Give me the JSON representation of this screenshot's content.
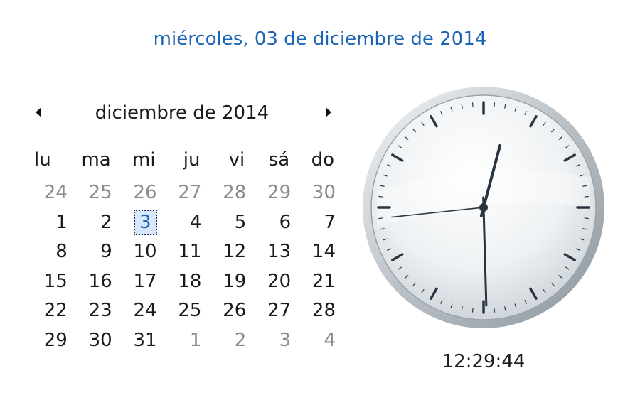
{
  "header": {
    "full_date": "miércoles, 03 de diciembre de 2014"
  },
  "calendar": {
    "month_title": "diciembre de 2014",
    "weekdays": [
      "lu",
      "ma",
      "mi",
      "ju",
      "vi",
      "sá",
      "do"
    ],
    "weeks": [
      [
        "24",
        "25",
        "26",
        "27",
        "28",
        "29",
        "30"
      ],
      [
        "1",
        "2",
        "3",
        "4",
        "5",
        "6",
        "7"
      ],
      [
        "8",
        "9",
        "10",
        "11",
        "12",
        "13",
        "14"
      ],
      [
        "15",
        "16",
        "17",
        "18",
        "19",
        "20",
        "21"
      ],
      [
        "22",
        "23",
        "24",
        "25",
        "26",
        "27",
        "28"
      ],
      [
        "29",
        "30",
        "31",
        "1",
        "2",
        "3",
        "4"
      ]
    ],
    "muted_cells": [
      [
        0,
        0
      ],
      [
        0,
        1
      ],
      [
        0,
        2
      ],
      [
        0,
        3
      ],
      [
        0,
        4
      ],
      [
        0,
        5
      ],
      [
        0,
        6
      ],
      [
        5,
        3
      ],
      [
        5,
        4
      ],
      [
        5,
        5
      ],
      [
        5,
        6
      ]
    ],
    "today_cell": [
      1,
      2
    ]
  },
  "clock": {
    "time": "12:29:44",
    "hours": 12,
    "minutes": 29,
    "seconds": 44,
    "face_color": "#eef1f3",
    "rim_color": "#b9c0c6",
    "hand_color": "#2a3440"
  }
}
